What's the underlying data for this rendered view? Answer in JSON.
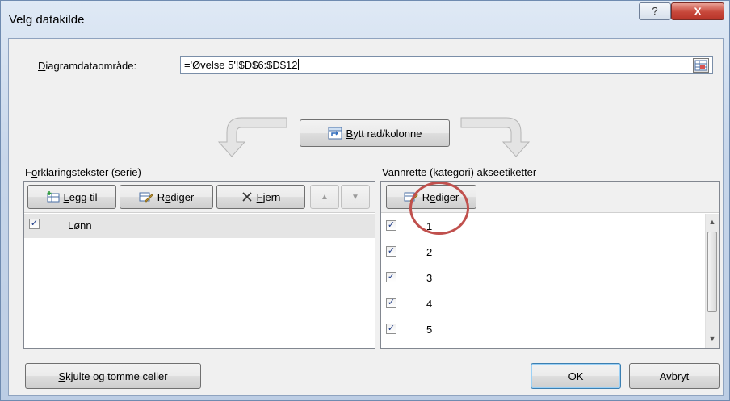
{
  "window": {
    "title": "Velg datakilde",
    "help_label": "?",
    "close_label": "X"
  },
  "range": {
    "label_underlined": "D",
    "label_rest": "iagramdataområde:",
    "value": "='Øvelse 5'!$D$6:$D$12"
  },
  "switch_button": {
    "label_underlined": "B",
    "label_rest": "ytt rad/kolonne"
  },
  "series_panel": {
    "heading_first": "F",
    "heading_underlined": "o",
    "heading_rest": "rklaringstekster (serie)",
    "add": {
      "underlined": "L",
      "rest": "egg til"
    },
    "edit": {
      "first": "R",
      "underlined": "e",
      "rest": "diger"
    },
    "remove": {
      "underlined": "F",
      "rest": "jern"
    },
    "up_label": "▲",
    "down_label": "▼",
    "items": [
      {
        "label": "Lønn",
        "checked": true
      }
    ]
  },
  "category_panel": {
    "heading": "Vannrette (kategori) akseetiketter",
    "edit": {
      "first": "R",
      "underlined": "e",
      "rest": "diger"
    },
    "items": [
      {
        "label": "1",
        "checked": true
      },
      {
        "label": "2",
        "checked": true
      },
      {
        "label": "3",
        "checked": true
      },
      {
        "label": "4",
        "checked": true
      },
      {
        "label": "5",
        "checked": true
      }
    ],
    "scroll_up": "▲",
    "scroll_down": "▼"
  },
  "footer": {
    "hidden_cells": {
      "underlined": "S",
      "rest": "kjulte og tomme celler"
    },
    "ok_label": "OK",
    "cancel_label": "Avbryt"
  },
  "colors": {
    "highlight_ring": "#c0504d",
    "close_button": "#c7473a",
    "frame": "#c9d7e8"
  }
}
